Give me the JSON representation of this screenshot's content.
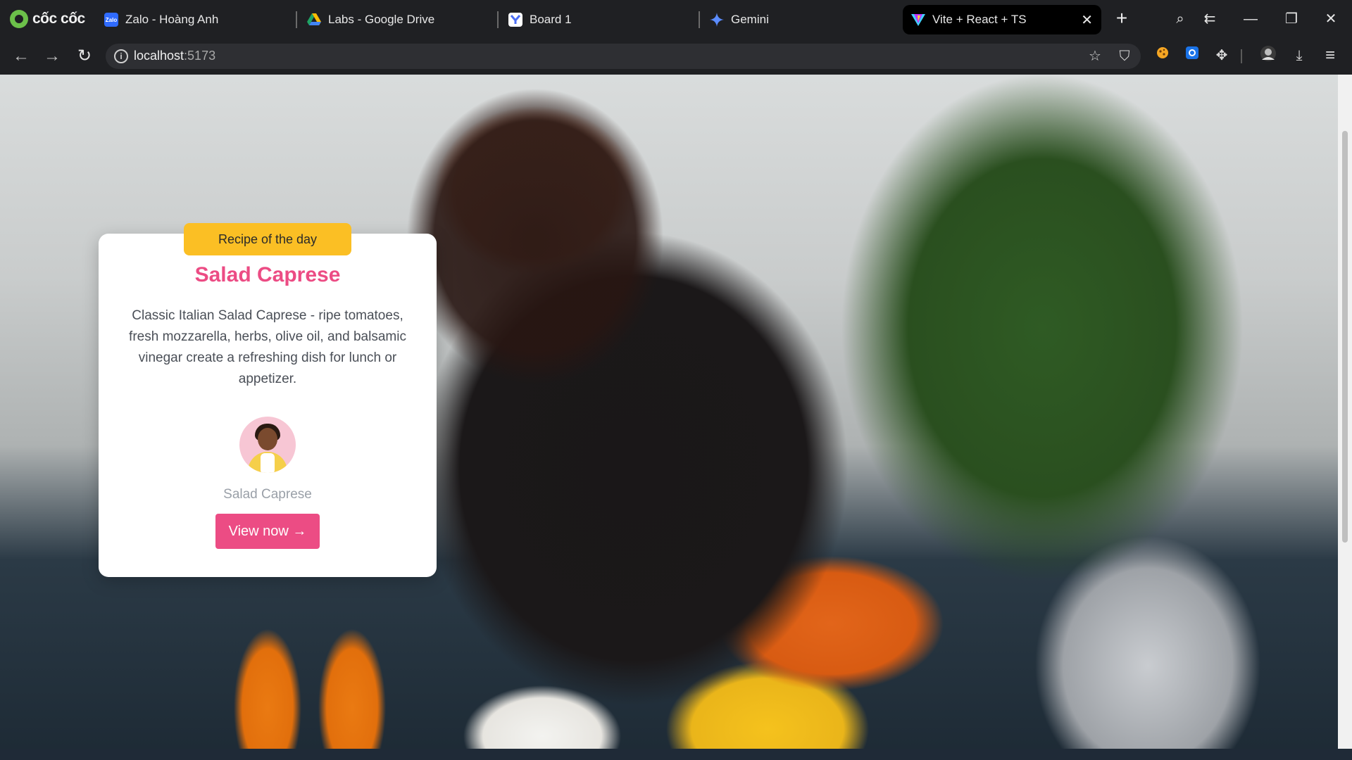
{
  "browser": {
    "brand": "cốc cốc",
    "tabs": [
      {
        "title": "Zalo - Hoàng Anh",
        "favicon": "zalo-icon",
        "favicon_text": "Zalo",
        "color": "#2f6bff"
      },
      {
        "title": "Labs - Google Drive",
        "favicon": "google-drive-icon",
        "color": "#1fa463"
      },
      {
        "title": "Board 1",
        "favicon": "board-icon",
        "color": "#4c6ef5"
      },
      {
        "title": "Gemini",
        "favicon": "gemini-icon",
        "color": "#5b8cff"
      },
      {
        "title": "Vite + React + TS",
        "favicon": "vite-icon",
        "color": "#bd34fe",
        "active": true
      }
    ],
    "address_host": "localhost",
    "address_port": ":5173",
    "glyphs": {
      "close": "✕",
      "new_tab": "+",
      "back": "←",
      "forward": "→",
      "reload": "↻",
      "info": "i",
      "star": "☆",
      "shield": "⛉",
      "extensions": "✥",
      "download": "⤓",
      "menu": "≡",
      "minimize": "—",
      "restore": "❐",
      "window_close": "✕",
      "search_tabs": "⌕",
      "tab_back": "⇇"
    }
  },
  "card": {
    "badge": "Recipe of the day",
    "title": "Salad Caprese",
    "description": "Classic Italian Salad Caprese - ripe tomatoes, fresh mozzarella, herbs, olive oil, and balsamic vinegar create a refreshing dish for lunch or appetizer.",
    "author": "Salad Caprese",
    "button": "View now →"
  },
  "colors": {
    "accent_pink": "#ec4c84",
    "badge_yellow": "#fbbf24",
    "text_gray": "#4a4f57",
    "muted_gray": "#9aa0a8"
  }
}
